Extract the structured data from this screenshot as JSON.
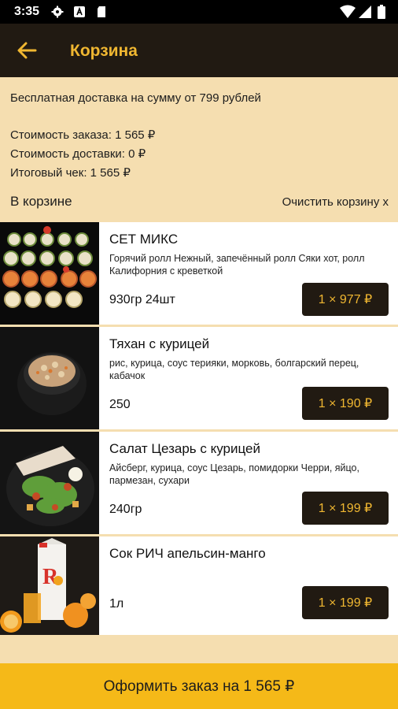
{
  "status_bar": {
    "time": "3:35",
    "icons": [
      "gear-icon",
      "a-box-icon",
      "sd-card-icon",
      "wifi-icon",
      "signal-icon",
      "battery-icon"
    ]
  },
  "header": {
    "title": "Корзина",
    "back_icon": "arrow-left-icon"
  },
  "summary": {
    "free_delivery": "Бесплатная доставка на сумму от 799 рублей",
    "order_cost": "Стоимость заказа: 1 565 ₽",
    "delivery_cost": "Стоимость доставки: 0 ₽",
    "total": "Итоговый чек: 1 565 ₽"
  },
  "cart": {
    "title": "В корзине",
    "clear_label": "Очистить корзину х",
    "items": [
      {
        "name": "СЕТ МИКС",
        "description": "Горячий ролл Нежный, запечённый ролл Сяки хот, ролл Калифорния с креветкой",
        "weight": "930гр 24шт",
        "price": "1 × 977 ₽"
      },
      {
        "name": "Тяхан с курицей",
        "description": "рис, курица, соус терияки, морковь, болгарский перец, кабачок",
        "weight": "250",
        "price": "1 × 190 ₽"
      },
      {
        "name": "Салат Цезарь с курицей",
        "description": "Айсберг, курица, соус Цезарь, помидорки Черри, яйцо, пармезан, сухари",
        "weight": "240гр",
        "price": "1 × 199 ₽"
      },
      {
        "name": "Сок РИЧ апельсин-манго",
        "description": "",
        "weight": "1л",
        "price": "1 × 199 ₽"
      }
    ]
  },
  "checkout": {
    "label": "Оформить заказ на 1 565 ₽"
  },
  "colors": {
    "accent": "#f0b731",
    "dark": "#211a12",
    "background": "#f5deb0",
    "checkout_bar": "#f5b918"
  }
}
